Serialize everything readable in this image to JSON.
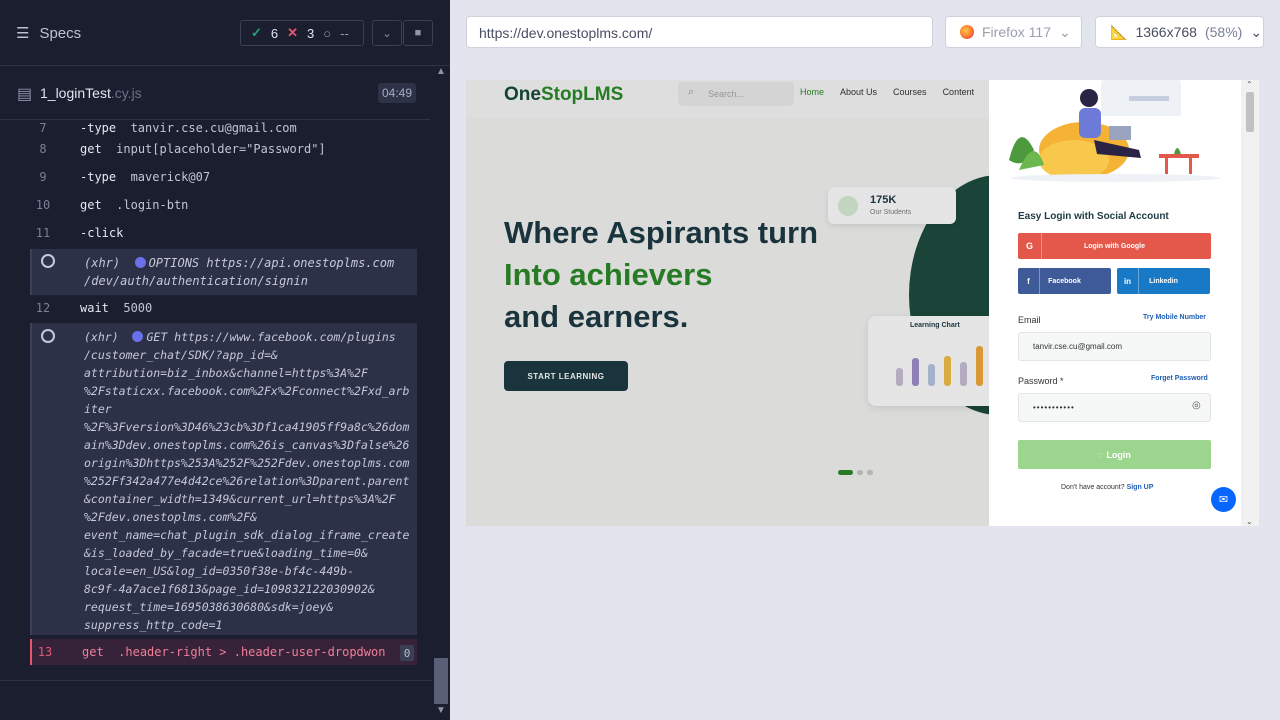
{
  "runner": {
    "title": "Specs",
    "passed": "6",
    "failed": "3",
    "pending": "--",
    "spec_file": "1_loginTest",
    "spec_ext": ".cy.js",
    "duration": "04:49"
  },
  "log": {
    "r7": {
      "num": "7",
      "cmd": "-type",
      "arg": "tanvir.cse.cu@gmail.com"
    },
    "r8": {
      "num": "8",
      "cmd": "get",
      "arg": "input[placeholder=\"Password\"]"
    },
    "r9": {
      "num": "9",
      "cmd": "-type",
      "arg": "maverick@07"
    },
    "r10": {
      "num": "10",
      "cmd": "get",
      "arg": ".login-btn"
    },
    "r11": {
      "num": "11",
      "cmd": "-click",
      "arg": ""
    },
    "xhr1": {
      "prefix": "(xhr)",
      "text": "OPTIONS https://api.onestoplms.com\n/dev/auth/authentication/signin"
    },
    "r12": {
      "num": "12",
      "cmd": "wait",
      "arg": "5000"
    },
    "xhr2": {
      "prefix": "(xhr)",
      "text": "GET https://www.facebook.com/plugins\n/customer_chat/SDK/?app_id=&\nattribution=biz_inbox&channel=https%3A%2F\n%2Fstaticxx.facebook.com%2Fx%2Fconnect%2Fxd_arb\niter\n%2F%3Fversion%3D46%23cb%3Df1ca41905ff9a8c%26dom\nain%3Ddev.onestoplms.com%26is_canvas%3Dfalse%26\norigin%3Dhttps%253A%252F%252Fdev.onestoplms.com\n%252Ff342a477e4d42ce%26relation%3Dparent.parent\n&container_width=1349&current_url=https%3A%2F\n%2Fdev.onestoplms.com%2F&\nevent_name=chat_plugin_sdk_dialog_iframe_create\n&is_loaded_by_facade=true&loading_time=0&\nlocale=en_US&log_id=0350f38e-bf4c-449b-\n8c9f-4a7ace1f6813&page_id=109832122030902&\nrequest_time=1695038630680&sdk=joey&\nsuppress_http_code=1"
    },
    "r13": {
      "num": "13",
      "cmd": "get",
      "arg": ".header-right > .header-user-dropdwon",
      "badge": "0"
    }
  },
  "browser": {
    "url": "https://dev.onestoplms.com/",
    "browser_name": "Firefox 117",
    "viewport": "1366x768",
    "scale": "(58%)"
  },
  "site": {
    "logo_a": "One",
    "logo_b": "StopLMS",
    "search_placeholder": "Search...",
    "nav": [
      "Home",
      "About Us",
      "Courses",
      "Content"
    ],
    "hero_line1": "Where Aspirants turn",
    "hero_line2": "Into achievers",
    "hero_line3": "and earners.",
    "cta": "START LEARNING",
    "stat_value": "175K",
    "stat_label": "Our Students",
    "chart_title": "Learning Chart"
  },
  "modal": {
    "title": "Easy Login with Social Account",
    "google": "Login with Google",
    "facebook": "Facebook",
    "linkedin": "Linkedin",
    "email_label": "Email",
    "mobile_link": "Try Mobile Number",
    "email_value": "tanvir.cse.cu@gmail.com",
    "password_label": "Password *",
    "forget_link": "Forget Password",
    "password_value": "•••••••••••",
    "login_btn": "Login",
    "no_account": "Don't have account?",
    "signup": "Sign UP"
  },
  "colors": {
    "runner_bg": "#1b1e2e",
    "pass": "#1fa971",
    "fail": "#e45770",
    "brand_green": "#2d8a2a",
    "brand_dark": "#1e3a44"
  }
}
